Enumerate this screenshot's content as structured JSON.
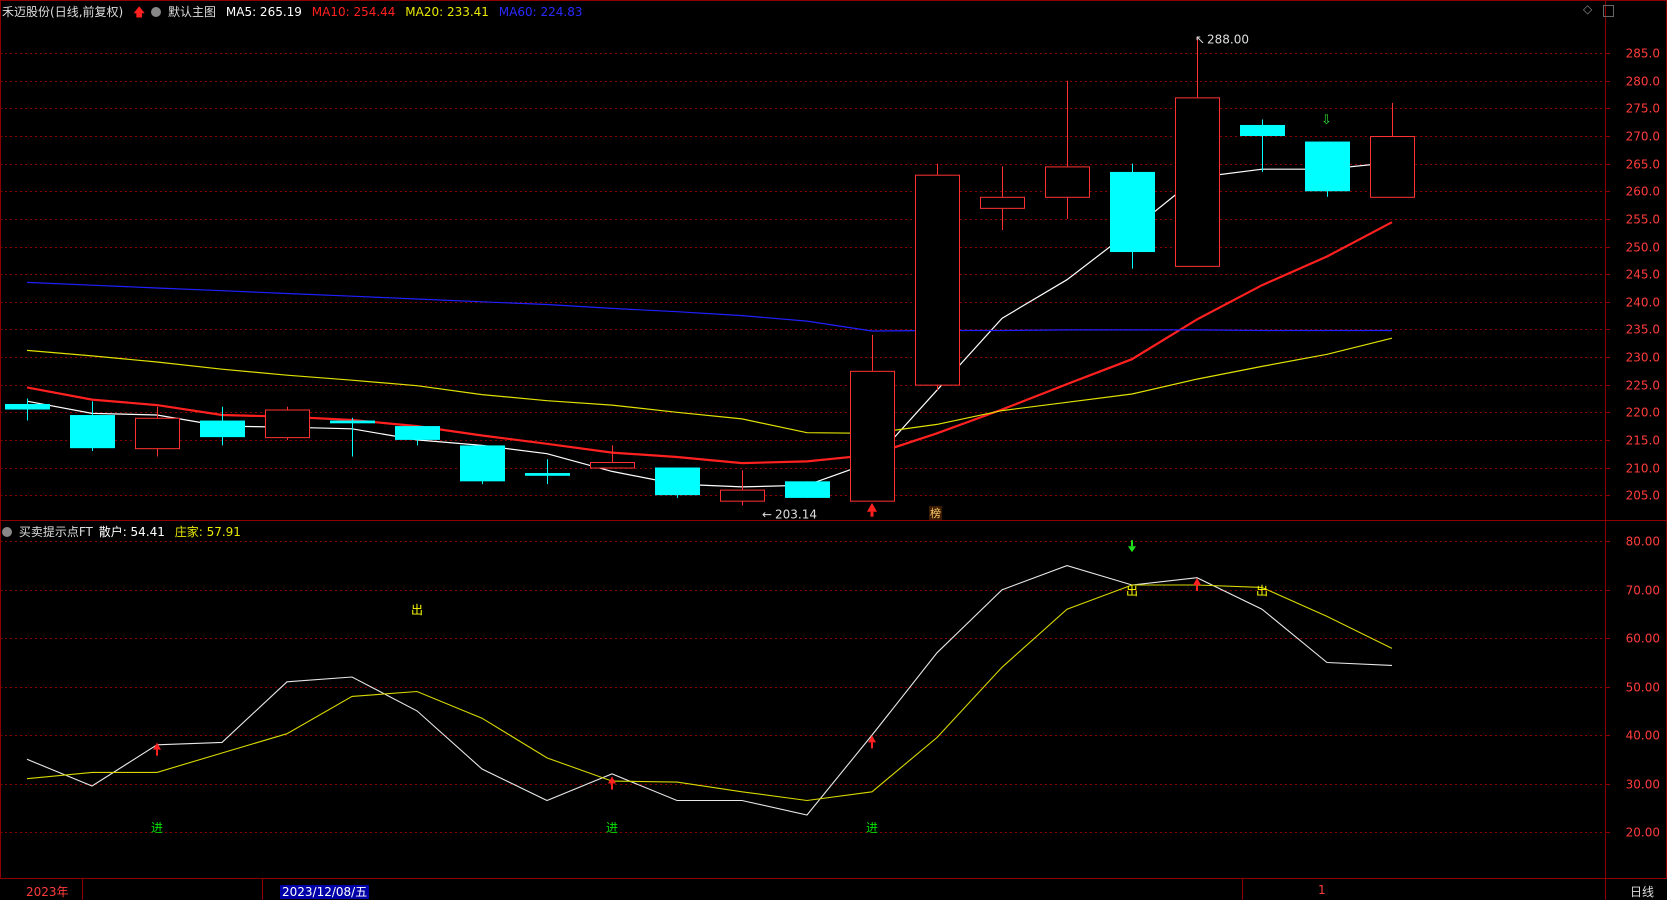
{
  "header": {
    "stock_name": "禾迈股份",
    "period_info": "(日线,前复权)",
    "main_chart_label": "默认主图",
    "ma5_label": "MA5: 265.19",
    "ma10_label": "MA10: 254.44",
    "ma20_label": "MA20: 233.41",
    "ma60_label": "MA60: 224.83"
  },
  "sub_header": {
    "indicator_name": "买卖提示点FT",
    "retail_label": "散户: 54.41",
    "banker_label": "庄家: 57.91"
  },
  "annotations": {
    "high_price": "288.00",
    "low_price": "203.14",
    "rank_badge": "榜",
    "sell_text": "出",
    "buy_text": "进"
  },
  "bottom_bar": {
    "year_label": "2023年",
    "current_date": "2023/12/08/五",
    "month_mark": "1",
    "period_button": "日线"
  },
  "colors": {
    "up": "#ff3232",
    "down": "#00ffff",
    "ma5": "#ffffff",
    "ma10": "#ff2020",
    "ma20": "#e0e000",
    "ma60": "#2020ff",
    "grid": "#8b0000",
    "axis_text": "#ff3c3c",
    "buy_text": "#00e000",
    "sell_text": "#ffff00"
  },
  "chart_data": [
    {
      "type": "candlestick",
      "y_axis_ticks": [
        205,
        210,
        215,
        220,
        225,
        230,
        235,
        240,
        245,
        250,
        255,
        260,
        265,
        270,
        275,
        280,
        285
      ],
      "y_axis_labels": [
        "205.0",
        "210.0",
        "215.0",
        "220.0",
        "225.0",
        "230.0",
        "235.0",
        "240.0",
        "245.0",
        "250.0",
        "255.0",
        "260.0",
        "265.0",
        "270.0",
        "275.0",
        "280.0",
        "285.0"
      ],
      "ylim": [
        200.5,
        291
      ],
      "candles": [
        {
          "o": 221.5,
          "h": 222.5,
          "l": 218.5,
          "c": 220.5
        },
        {
          "o": 219.5,
          "h": 222.0,
          "l": 213.0,
          "c": 213.5
        },
        {
          "o": 213.5,
          "h": 221.0,
          "l": 212.0,
          "c": 219.0
        },
        {
          "o": 218.5,
          "h": 221.0,
          "l": 214.0,
          "c": 215.5
        },
        {
          "o": 215.5,
          "h": 221.0,
          "l": 215.0,
          "c": 220.5
        },
        {
          "o": 218.5,
          "h": 219.0,
          "l": 212.0,
          "c": 218.0
        },
        {
          "o": 217.5,
          "h": 217.5,
          "l": 214.0,
          "c": 215.0
        },
        {
          "o": 214.0,
          "h": 214.0,
          "l": 207.0,
          "c": 207.5
        },
        {
          "o": 209.0,
          "h": 211.5,
          "l": 207.0,
          "c": 208.5
        },
        {
          "o": 210.0,
          "h": 214.0,
          "l": 210.0,
          "c": 211.0
        },
        {
          "o": 210.0,
          "h": 210.0,
          "l": 204.5,
          "c": 205.0
        },
        {
          "o": 204.0,
          "h": 209.5,
          "l": 203.14,
          "c": 206.0
        },
        {
          "o": 207.5,
          "h": 207.5,
          "l": 204.5,
          "c": 204.5
        },
        {
          "o": 204.0,
          "h": 234.0,
          "l": 204.0,
          "c": 227.5
        },
        {
          "o": 225.0,
          "h": 265.0,
          "l": 224.0,
          "c": 263.0
        },
        {
          "o": 257.0,
          "h": 264.5,
          "l": 253.0,
          "c": 259.0
        },
        {
          "o": 259.0,
          "h": 280.0,
          "l": 255.0,
          "c": 264.5
        },
        {
          "o": 263.5,
          "h": 265.0,
          "l": 246.0,
          "c": 249.0
        },
        {
          "o": 246.5,
          "h": 288.0,
          "l": 246.5,
          "c": 277.0
        },
        {
          "o": 272.0,
          "h": 273.0,
          "l": 263.5,
          "c": 270.0
        },
        {
          "o": 269.0,
          "h": 269.0,
          "l": 259.0,
          "c": 260.0
        },
        {
          "o": 259.0,
          "h": 276.0,
          "l": 259.0,
          "c": 270.0
        }
      ],
      "ma_lines": [
        {
          "name": "MA5",
          "values": [
            222,
            219.8,
            219.5,
            217.5,
            217.3,
            217,
            215,
            214,
            212.5,
            209.3,
            207,
            206.5,
            206.8,
            211,
            224,
            237,
            244,
            253,
            262.5,
            264,
            264,
            265.2
          ]
        },
        {
          "name": "MA10",
          "values": [
            224.5,
            222.3,
            221.3,
            219.5,
            219.2,
            218.6,
            217.5,
            215.8,
            214.3,
            212.7,
            211.9,
            210.8,
            211.1,
            212.3,
            216.2,
            220.5,
            225.1,
            229.6,
            236.8,
            243,
            248.2,
            254.4
          ]
        },
        {
          "name": "MA20",
          "values": [
            231.2,
            230.2,
            229.1,
            227.8,
            226.7,
            225.8,
            224.8,
            223.2,
            222.1,
            221.3,
            220,
            218.8,
            216.3,
            216.2,
            217.8,
            220.3,
            221.8,
            223.3,
            226,
            228.3,
            230.5,
            233.4
          ]
        },
        {
          "name": "MA60",
          "values": [
            243.5,
            243,
            242.5,
            242,
            241.5,
            241,
            240.5,
            240,
            239.5,
            238.8,
            238.2,
            237.5,
            236.5,
            234.7,
            234.8,
            234.8,
            234.9,
            234.9,
            234.9,
            234.8,
            234.8,
            234.8
          ]
        }
      ]
    },
    {
      "type": "line",
      "y_axis_ticks": [
        20,
        30,
        40,
        50,
        60,
        70,
        80
      ],
      "y_axis_labels": [
        "20.00",
        "30.00",
        "40.00",
        "50.00",
        "60.00",
        "70.00",
        "80.00"
      ],
      "ylim": [
        10.5,
        84
      ],
      "series": [
        {
          "name": "散户",
          "values": [
            35,
            29.5,
            38,
            38.5,
            51,
            52,
            45,
            33,
            26.5,
            32,
            26.5,
            26.5,
            23.5,
            40,
            57,
            70,
            75,
            71,
            72.5,
            66,
            55,
            54.4
          ]
        },
        {
          "name": "庄家",
          "values": [
            31,
            32.3,
            32.3,
            36.3,
            40.3,
            48,
            49,
            43.5,
            35.3,
            30.5,
            30.3,
            28.3,
            26.5,
            28.3,
            39.5,
            54,
            66,
            71,
            71,
            70.5,
            64.5,
            57.9
          ]
        }
      ],
      "markers": [
        {
          "index": 2,
          "type": "buy-arrow",
          "value": 37
        },
        {
          "index": 9,
          "type": "buy-arrow",
          "value": 30
        },
        {
          "index": 13,
          "type": "buy-arrow",
          "value": 38.5
        },
        {
          "index": 18,
          "type": "buy-arrow",
          "value": 71
        },
        {
          "index": 17,
          "type": "sell-arrow",
          "value": 79
        },
        {
          "index": 6,
          "type": "sell-text",
          "value": 66
        },
        {
          "index": 17,
          "type": "sell-text",
          "value": 70
        },
        {
          "index": 19,
          "type": "sell-text",
          "value": 70
        },
        {
          "index": 2,
          "type": "buy-text",
          "value": 21
        },
        {
          "index": 9,
          "type": "buy-text",
          "value": 21
        },
        {
          "index": 13,
          "type": "buy-text",
          "value": 21
        }
      ]
    }
  ]
}
